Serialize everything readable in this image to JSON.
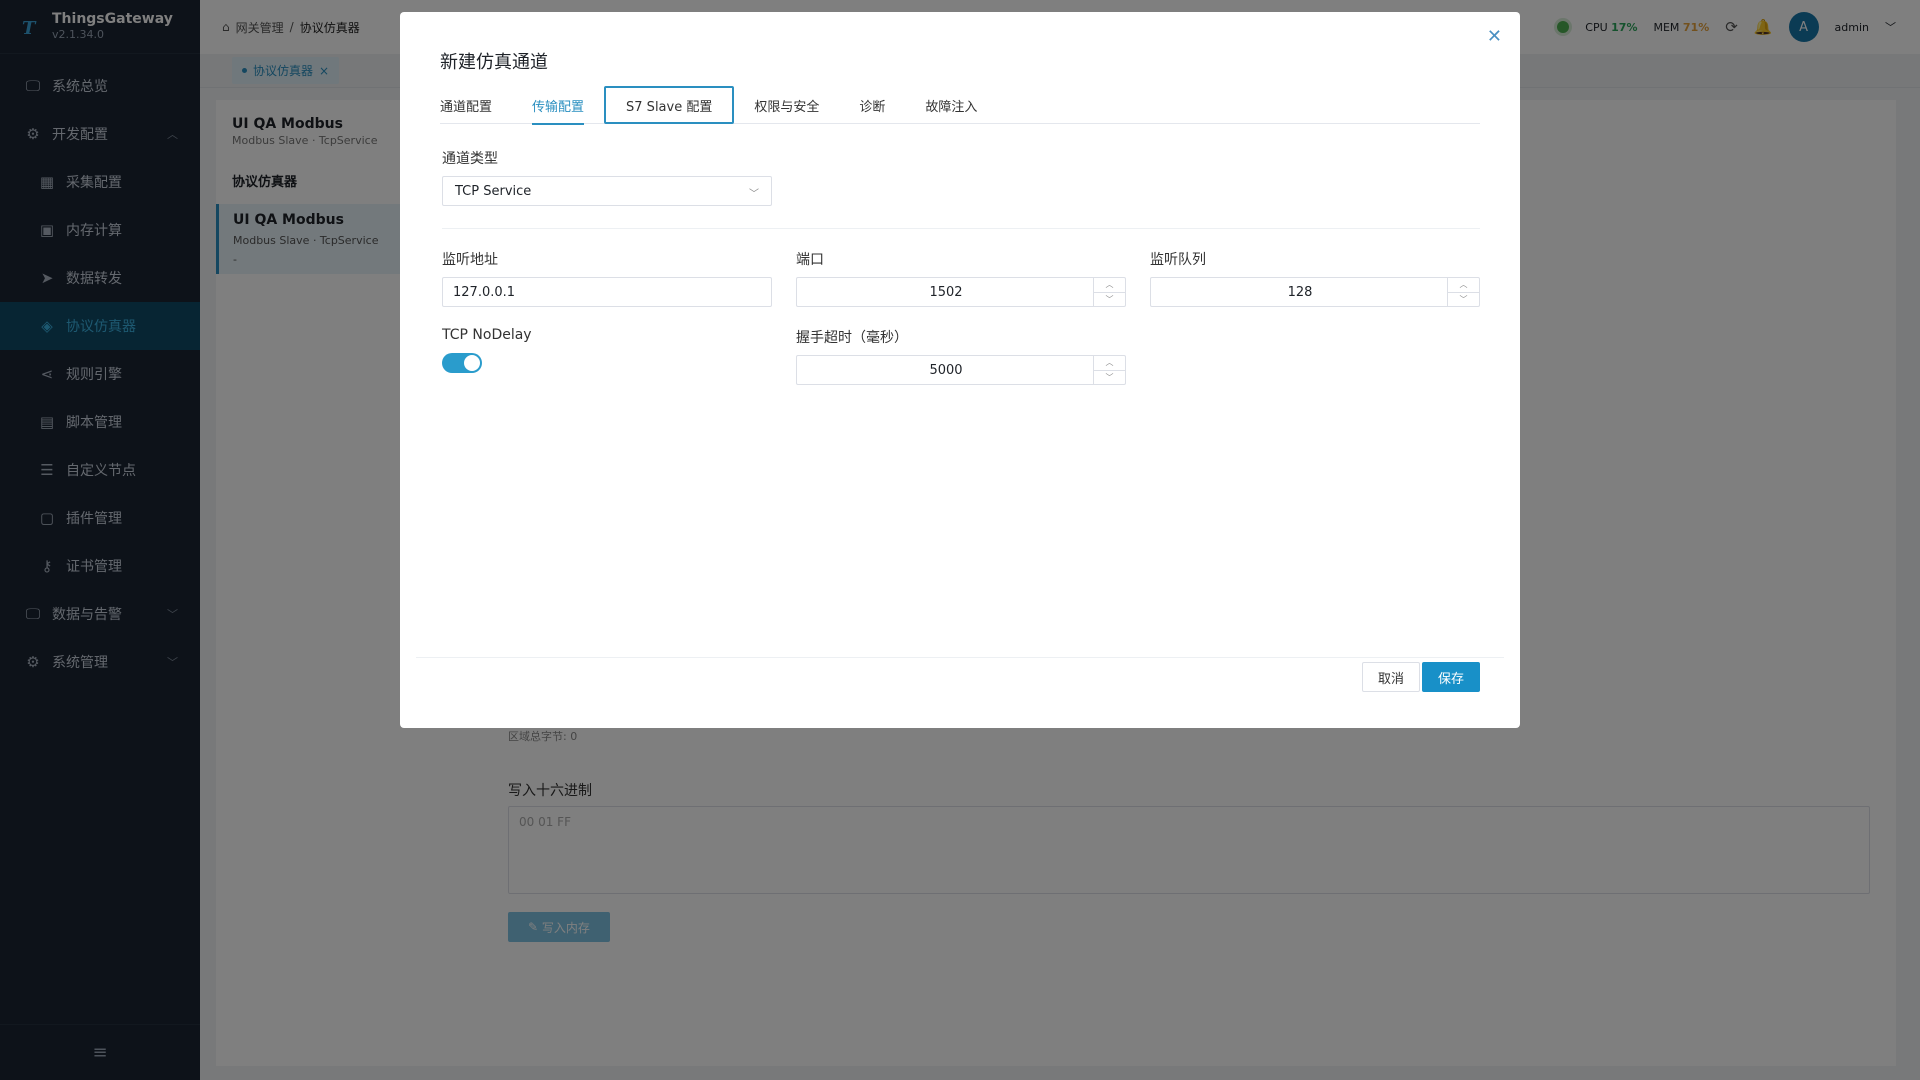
{
  "app": {
    "name": "ThingsGateway",
    "version": "v2.1.34.0"
  },
  "sidebar": {
    "items": [
      {
        "label": "系统总览",
        "icon": "monitor-icon"
      },
      {
        "label": "开发配置",
        "icon": "gear-icon"
      },
      {
        "label": "采集配置",
        "icon": "chart-board-icon"
      },
      {
        "label": "内存计算",
        "icon": "chip-icon"
      },
      {
        "label": "数据转发",
        "icon": "send-icon"
      },
      {
        "label": "协议仿真器",
        "icon": "layers-icon"
      },
      {
        "label": "规则引擎",
        "icon": "share-icon"
      },
      {
        "label": "脚本管理",
        "icon": "file-icon"
      },
      {
        "label": "自定义节点",
        "icon": "sliders-icon"
      },
      {
        "label": "插件管理",
        "icon": "package-icon"
      },
      {
        "label": "证书管理",
        "icon": "key-icon"
      },
      {
        "label": "数据与告警",
        "icon": "monitor-icon"
      },
      {
        "label": "系统管理",
        "icon": "gear-icon"
      }
    ]
  },
  "header": {
    "breadcrumb": [
      "网关管理",
      "协议仿真器"
    ],
    "cpu_label": "CPU",
    "cpu_value": "17%",
    "mem_label": "MEM",
    "mem_value": "71%",
    "user": "admin",
    "avatar_letter": "A"
  },
  "tabbar": {
    "tab": "协议仿真器"
  },
  "background": {
    "title": "UI QA Modbus",
    "subtitle": "Modbus Slave · TcpService",
    "section": "协议仿真器",
    "item_title": "UI QA Modbus",
    "item_sub": "Modbus Slave · TcpService",
    "item_extra": "-",
    "bytes_note": "区域总字节: 0",
    "hex_label": "写入十六进制",
    "hex_placeholder": "00 01 FF",
    "write_button": "写入内存"
  },
  "modal": {
    "title": "新建仿真通道",
    "tabs": [
      "通道配置",
      "传输配置",
      "S7 Slave 配置",
      "权限与安全",
      "诊断",
      "故障注入"
    ],
    "active_tab": 1,
    "fields": {
      "channel_type_label": "通道类型",
      "channel_type_value": "TCP Service",
      "listen_addr_label": "监听地址",
      "listen_addr_value": "127.0.0.1",
      "port_label": "端口",
      "port_value": "1502",
      "queue_label": "监听队列",
      "queue_value": "128",
      "nodelay_label": "TCP NoDelay",
      "nodelay_on": true,
      "handshake_label": "握手超时（毫秒）",
      "handshake_value": "5000"
    },
    "cancel_label": "取消",
    "save_label": "保存"
  },
  "colors": {
    "accent": "#2a8fc0",
    "sidebar_bg": "#1a2433",
    "save": "#1890c8"
  }
}
